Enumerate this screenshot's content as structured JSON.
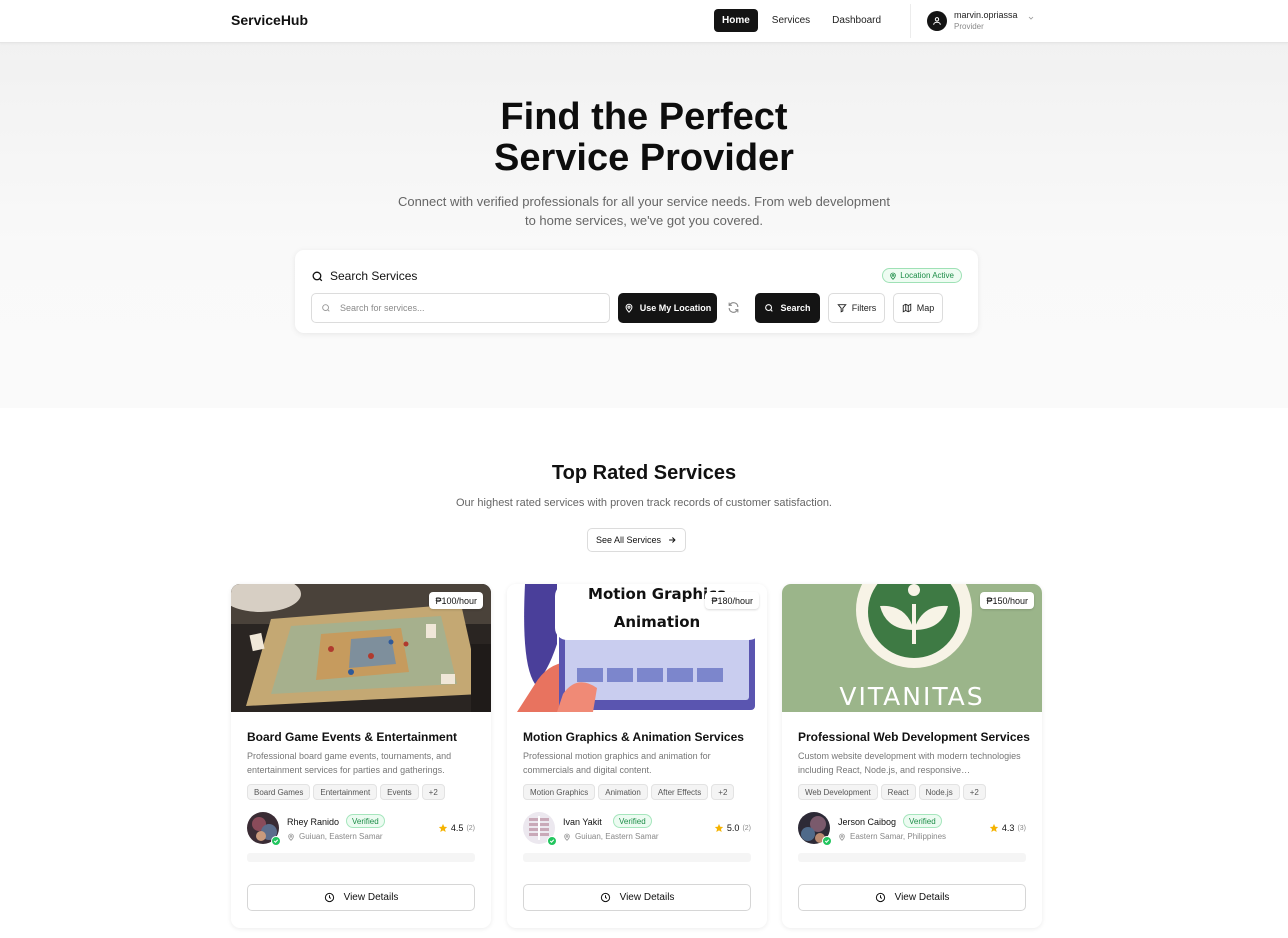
{
  "nav": {
    "brand": "ServiceHub",
    "links": [
      "Home",
      "Services",
      "Dashboard"
    ],
    "active_link": "Home",
    "user": {
      "name": "marvin.opriassa",
      "role": "Provider"
    }
  },
  "hero": {
    "title_line1": "Find the Perfect",
    "title_line2": "Service Provider",
    "subtitle_line1": "Connect with verified professionals for all your service needs. From web development",
    "subtitle_line2": "to home services, we've got you covered."
  },
  "search": {
    "heading": "Search Services",
    "location_badge": "Location Active",
    "placeholder": "Search for services...",
    "use_location_label": "Use My Location",
    "search_label": "Search",
    "filters_label": "Filters",
    "map_label": "Map"
  },
  "top_rated": {
    "title": "Top Rated Services",
    "subtitle": "Our highest rated services with proven track records of customer satisfaction.",
    "see_all_label": "See All Services"
  },
  "cards": [
    {
      "price": "₱100/hour",
      "title": "Board Game Events & Entertainment",
      "description": "Professional board game events, tournaments, and entertainment services for parties and gatherings.",
      "tags": [
        "Board Games",
        "Entertainment",
        "Events",
        "+2"
      ],
      "provider": "Rhey Ranido",
      "verified": "Verified",
      "location": "Guiuan, Eastern Samar",
      "rating": "4.5",
      "reviews": "(2)",
      "view_label": "View Details"
    },
    {
      "price": "₱180/hour",
      "image_text_line1": "Motion Graphics",
      "image_text_line2": "Animation",
      "title": "Motion Graphics & Animation Services",
      "description": "Professional motion graphics and animation for commercials and digital content.",
      "tags": [
        "Motion Graphics",
        "Animation",
        "After Effects",
        "+2"
      ],
      "provider": "Ivan Yakit",
      "verified": "Verified",
      "location": "Guiuan, Eastern Samar",
      "rating": "5.0",
      "reviews": "(2)",
      "view_label": "View Details"
    },
    {
      "price": "₱150/hour",
      "image_text": "VITANITAS",
      "title": "Professional Web Development Services",
      "description": "Custom website development with modern technologies including React, Node.js, and responsive…",
      "tags": [
        "Web Development",
        "React",
        "Node.js",
        "+2"
      ],
      "provider": "Jerson Caibog",
      "verified": "Verified",
      "location": "Eastern Samar, Philippines",
      "rating": "4.3",
      "reviews": "(3)",
      "view_label": "View Details"
    }
  ],
  "colors": {
    "primary": "#141414",
    "success": "#22c55e",
    "star": "#f5b301"
  }
}
